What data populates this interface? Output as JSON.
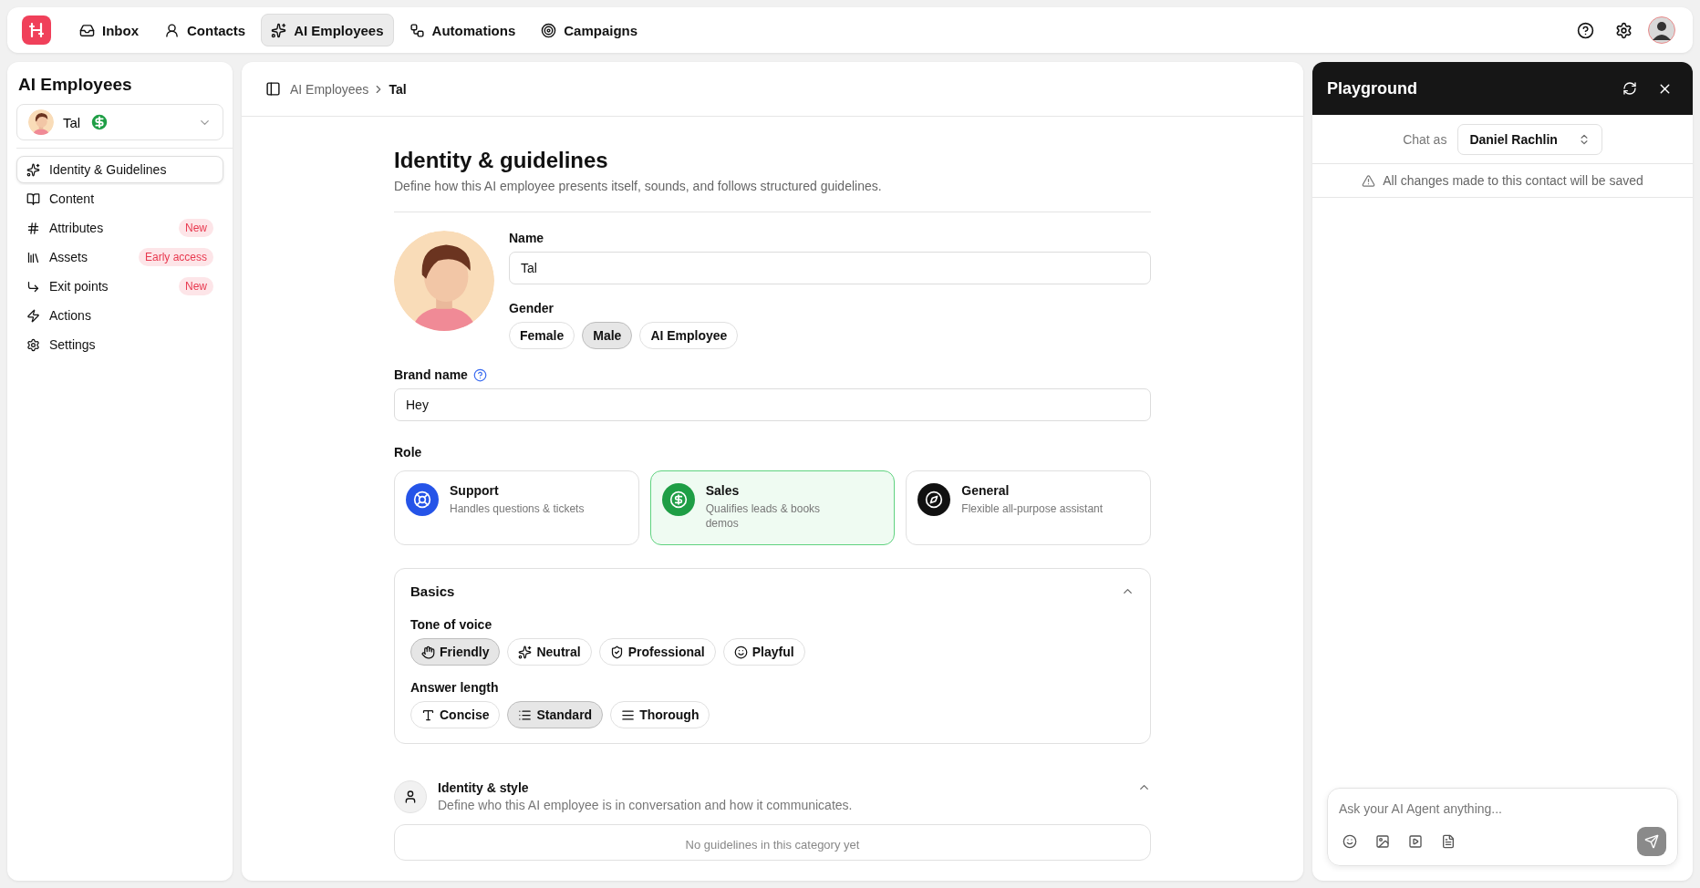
{
  "nav": {
    "items": [
      {
        "label": "Inbox",
        "selected": false
      },
      {
        "label": "Contacts",
        "selected": false
      },
      {
        "label": "AI Employees",
        "selected": true
      },
      {
        "label": "Automations",
        "selected": false
      },
      {
        "label": "Campaigns",
        "selected": false
      }
    ]
  },
  "sidebar": {
    "title": "AI Employees",
    "employee": {
      "name": "Tal"
    },
    "items": [
      {
        "label": "Identity & Guidelines",
        "selected": true
      },
      {
        "label": "Content",
        "selected": false
      },
      {
        "label": "Attributes",
        "selected": false,
        "badge": "New"
      },
      {
        "label": "Assets",
        "selected": false,
        "badge": "Early access"
      },
      {
        "label": "Exit points",
        "selected": false,
        "badge": "New"
      },
      {
        "label": "Actions",
        "selected": false
      },
      {
        "label": "Settings",
        "selected": false
      }
    ]
  },
  "breadcrumb": [
    "AI Employees",
    "Tal"
  ],
  "page": {
    "title": "Identity & guidelines",
    "subtitle": "Define how this AI employee presents itself, sounds, and follows structured guidelines.",
    "name_label": "Name",
    "name_value": "Tal",
    "gender_label": "Gender",
    "genders": [
      {
        "label": "Female",
        "selected": false
      },
      {
        "label": "Male",
        "selected": true
      },
      {
        "label": "AI Employee",
        "selected": false
      }
    ],
    "brand_label": "Brand name",
    "brand_value": "Hey",
    "role_label": "Role",
    "roles": [
      {
        "title": "Support",
        "description": "Handles questions & tickets",
        "selected": false
      },
      {
        "title": "Sales",
        "description": "Qualifies leads & books demos",
        "selected": true
      },
      {
        "title": "General",
        "description": "Flexible all-purpose assistant",
        "selected": false
      }
    ]
  },
  "basics": {
    "title": "Basics",
    "expanded": true,
    "tone_label": "Tone of voice",
    "tones": [
      {
        "label": "Friendly",
        "selected": true
      },
      {
        "label": "Neutral",
        "selected": false
      },
      {
        "label": "Professional",
        "selected": false
      },
      {
        "label": "Playful",
        "selected": false
      }
    ],
    "length_label": "Answer length",
    "lengths": [
      {
        "label": "Concise",
        "selected": false
      },
      {
        "label": "Standard",
        "selected": true
      },
      {
        "label": "Thorough",
        "selected": false
      }
    ]
  },
  "identity_style": {
    "title": "Identity & style",
    "description": "Define who this AI employee is in conversation and how it communicates.",
    "expanded": true,
    "empty_text": "No guidelines in this category yet"
  },
  "playground": {
    "title": "Playground",
    "chat_as_label": "Chat as",
    "chat_as_value": "Daniel Rachlin",
    "notice": "All changes made to this contact will be saved",
    "input_placeholder": "Ask your AI Agent anything..."
  }
}
